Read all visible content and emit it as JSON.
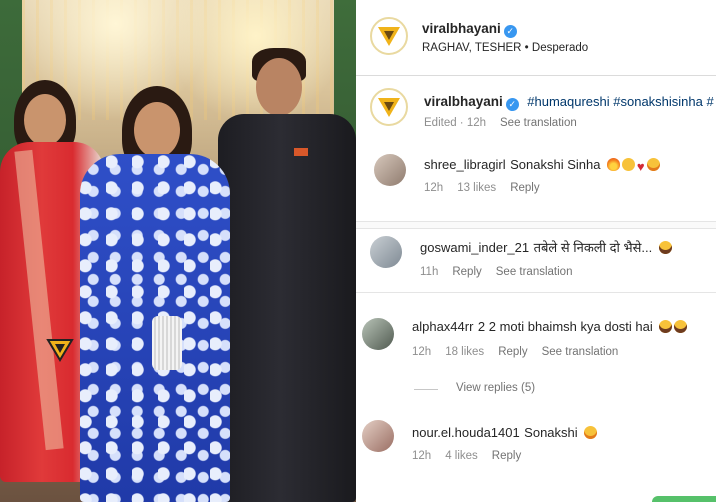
{
  "post": {
    "author": "viralbhayani",
    "audio": "RAGHAV, TESHER • Desperado"
  },
  "caption": {
    "author": "viralbhayani",
    "text": "#humaqureshi #sonakshisinha #",
    "edited": "Edited · 12h",
    "see_translation": "See translation"
  },
  "comments": [
    {
      "user": "shree_libragirl",
      "text": "Sonakshi Sinha",
      "emojis": [
        "fire-emoji",
        "scream-emoji",
        "heart-emoji",
        "starry-eyes-emoji"
      ],
      "time": "12h",
      "likes": "13 likes",
      "reply": "Reply",
      "see_translation": ""
    },
    {
      "user": "goswami_inder_21",
      "text": "तबेले से निकली दो भैसे...",
      "emojis": [
        "laughing-emoji"
      ],
      "time": "11h",
      "likes": "",
      "reply": "Reply",
      "see_translation": "See translation"
    },
    {
      "user": "alphax44rr",
      "text": "2 2 moti bhaimsh kya dosti hai",
      "emojis": [
        "laughing-emoji",
        "laughing-emoji"
      ],
      "time": "12h",
      "likes": "18 likes",
      "reply": "Reply",
      "see_translation": "See translation"
    },
    {
      "user": "nour.el.houda1401",
      "text": "Sonakshi",
      "emojis": [
        "starry-eyes-emoji"
      ],
      "time": "12h",
      "likes": "4 likes",
      "reply": "Reply",
      "see_translation": ""
    }
  ],
  "view_replies": "View replies (5)",
  "colors": {
    "verified": "#3897f0",
    "hashtag": "#00376b",
    "muted": "#8e8e8e"
  }
}
